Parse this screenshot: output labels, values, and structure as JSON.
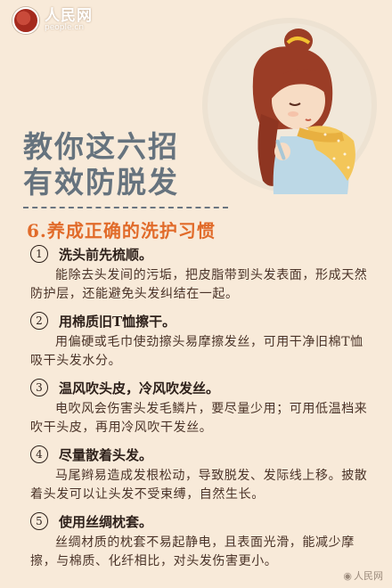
{
  "logo": {
    "name_cn": "人民网",
    "url": "people.cn"
  },
  "title": {
    "line1": "教你这六招",
    "line2": "有效防脱发"
  },
  "section": {
    "heading": "6.养成正确的洗护习惯"
  },
  "items": [
    {
      "num": "1",
      "heading": "洗头前先梳顺。",
      "body": "能除去头发间的污垢，把皮脂带到头发表面，形成天然防护层，还能避免头发纠结在一起。"
    },
    {
      "num": "2",
      "heading": "用棉质旧T恤擦干。",
      "body": "用偏硬或毛巾使劲擦头易摩擦发丝，可用干净旧棉T恤吸干头发水分。"
    },
    {
      "num": "3",
      "heading": "温风吹头皮，冷风吹发丝。",
      "body": "电吹风会伤害头发毛鳞片，要尽量少用；可用低温档来吹干头皮，再用冷风吹干发丝。"
    },
    {
      "num": "4",
      "heading": "尽量散着头发。",
      "body": "马尾辫易造成发根松动，导致脱发、发际线上移。披散着头发可以让头发不受束缚，自然生长。"
    },
    {
      "num": "5",
      "heading": "使用丝绸枕套。",
      "body": "丝绸材质的枕套不易起静电，且表面光滑，能减少摩擦，与棉质、化纤相比，对头发伤害更小。"
    }
  ],
  "watermark": "人民网",
  "colors": {
    "background": "#f8ead9",
    "title": "#66737e",
    "section": "#e16b2a"
  }
}
